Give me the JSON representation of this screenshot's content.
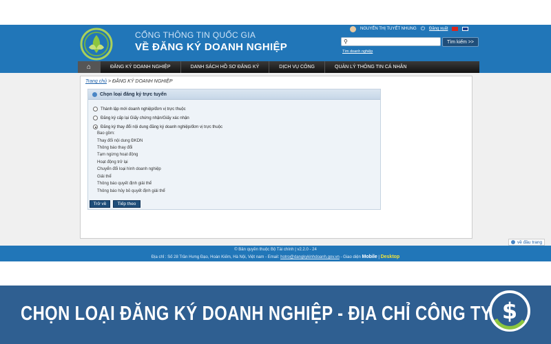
{
  "site": {
    "title_line1": "CỔNG THÔNG TIN QUỐC GIA",
    "title_line2": "VỀ ĐĂNG KÝ DOANH NGHIỆP"
  },
  "user": {
    "name": "NGUYỄN THỊ TUYẾT NHUNG",
    "logout": "Đăng xuất"
  },
  "search": {
    "placeholder": "",
    "button": "Tìm kiếm >>",
    "advanced_link": "Tìm doanh nghiệp"
  },
  "nav": {
    "home_icon": "home-icon",
    "items": [
      "ĐĂNG KÝ DOANH NGHIỆP",
      "DANH SÁCH HỒ SƠ ĐĂNG KÝ",
      "DỊCH VỤ CÔNG",
      "QUẢN LÝ THÔNG TIN CÁ NHÂN"
    ]
  },
  "breadcrumb": {
    "home": "Trang chủ",
    "separator": " > ",
    "current": "ĐĂNG KÝ DOANH NGHIỆP"
  },
  "panel": {
    "title": "Chọn loại đăng ký trực tuyến",
    "options": [
      {
        "label": "Thành lập mới doanh nghiệp/đơn vị trực thuộc",
        "checked": false
      },
      {
        "label": "Đăng ký cấp lại Giấy chứng nhận/Giấy xác nhận",
        "checked": false
      },
      {
        "label": "Đăng ký thay đổi nội dung đăng ký doanh nghiệp/đơn vị trực thuộc",
        "checked": true
      }
    ],
    "includes_label": "Bao gồm:",
    "includes": [
      "Thay đổi nội dung ĐKDN",
      "Thông báo thay đổi",
      "Tạm ngừng hoạt động",
      "Hoạt động trở lại",
      "Chuyển đổi loại hình doanh nghiệp",
      "Giải thể",
      "Thông báo quyết định giải thể",
      "Thông báo hủy bỏ quyết định giải thể"
    ],
    "back_button": "Trở về",
    "next_button": "Tiếp theo"
  },
  "back_to_top": "về đầu trang",
  "footer": {
    "line1": "© Bản quyền thuộc Bộ Tài chính | v2.2.0 - 24",
    "line2_prefix": "Địa chỉ : Số 28 Trần Hưng Đạo, Hoàn Kiếm, Hà Nội, Việt nam - Email: ",
    "email": "hotro@dangkykinhdoanh.gov.vn",
    "line2_mid": " - Giao diện ",
    "mobile": "Mobile",
    "divider": " | ",
    "desktop": "Desktop"
  },
  "caption": "CHỌN LOẠI ĐĂNG KÝ DOANH NGHIỆP - ĐỊA CHỈ CÔNG TY",
  "colors": {
    "banner": "#2176b8",
    "navbar": "#1a1a1a",
    "button": "#1f4e7a",
    "caption_band": "#2f5f91",
    "desktop_link": "#f2e33a"
  }
}
